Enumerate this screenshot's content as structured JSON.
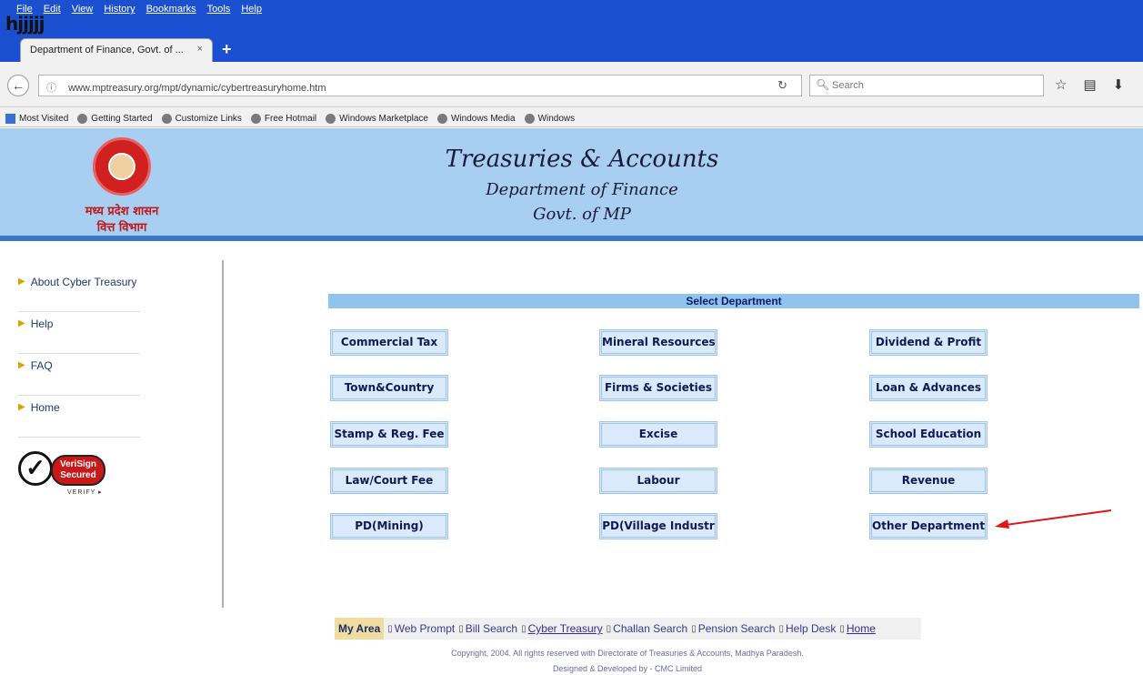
{
  "browser": {
    "menus": [
      "File",
      "Edit",
      "View",
      "History",
      "Bookmarks",
      "Tools",
      "Help"
    ],
    "scribble": "hjjjjj",
    "tab_title": "Department of Finance, Govt. of ...",
    "tab_close": "×",
    "new_tab": "+",
    "url": "www.mptreasury.org/mpt/dynamic/cybertreasuryhome.htm",
    "search_placeholder": "Search",
    "bookmarks": [
      "Most Visited",
      "Getting Started",
      "Customize Links",
      "Free Hotmail",
      "Windows Marketplace",
      "Windows Media",
      "Windows"
    ],
    "accent": "#1a4fd0"
  },
  "header": {
    "title": "Treasuries & Accounts",
    "subtitle1": "Department of Finance",
    "subtitle2": "Govt. of MP",
    "emblem_line1": "मध्य प्रदेश शासन",
    "emblem_line2": "वित्त विभाग",
    "bg_color": "#a8cff2"
  },
  "leftnav": {
    "items": [
      "About Cyber Treasury",
      "Help",
      "FAQ",
      "Home"
    ]
  },
  "verisign": {
    "badge_line1": "VeriSign",
    "badge_line2": "Secured",
    "verify": "VERIFY ▸"
  },
  "main": {
    "select_heading": "Select Department",
    "departments": [
      "Commercial Tax",
      "Mineral Resources",
      "Dividend & Profit",
      "Town&Country",
      "Firms & Societies",
      "Loan & Advances",
      "Stamp & Reg. Fee",
      "Excise",
      "School Education",
      "Law/Court Fee",
      "Labour",
      "Revenue",
      "PD(Mining)",
      "PD(Village Industr",
      "Other Department"
    ]
  },
  "footer": {
    "my_area": "My Area",
    "links": [
      "Web Prompt",
      "Bill Search",
      "Cyber Treasury",
      "Challan Search",
      "Pension Search",
      "Help Desk",
      "Home"
    ],
    "copyright": "Copyright, 2004. All rights reserved with Directorate of Treasuries & Accounts, Madhya Paradesh.",
    "designed": "Designed & Developed by - CMC Limited"
  }
}
